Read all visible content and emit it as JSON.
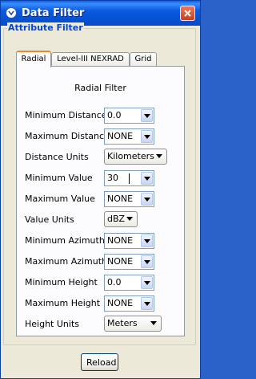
{
  "window": {
    "title": "Data Filter"
  },
  "group": {
    "label": "Attribute Filter"
  },
  "tabs": [
    {
      "label": "Radial",
      "active": true
    },
    {
      "label": "Level-III NEXRAD",
      "active": false
    },
    {
      "label": "Grid",
      "active": false
    }
  ],
  "panel": {
    "title": "Radial Filter",
    "fields": [
      {
        "label": "Minimum Distance",
        "value": "0.0"
      },
      {
        "label": "Maximum Distance",
        "value": "NONE"
      },
      {
        "label": "Distance Units",
        "value": "Kilometers"
      },
      {
        "label": "Minimum Value",
        "value": "30"
      },
      {
        "label": "Maximum Value",
        "value": "NONE"
      },
      {
        "label": "Value Units",
        "value": "dBZ"
      },
      {
        "label": "Minimum Azimuth",
        "value": "NONE"
      },
      {
        "label": "Maximum Azimuth",
        "value": "NONE"
      },
      {
        "label": "Minimum Height",
        "value": "0.0"
      },
      {
        "label": "Maximum Height",
        "value": "NONE"
      },
      {
        "label": "Height Units",
        "value": "Meters"
      }
    ]
  },
  "buttons": {
    "reload": "Reload"
  },
  "colors": {
    "titlebar": "#0553d6",
    "group_label": "#0046d5",
    "active_tab_accent": "#e68b2c"
  }
}
